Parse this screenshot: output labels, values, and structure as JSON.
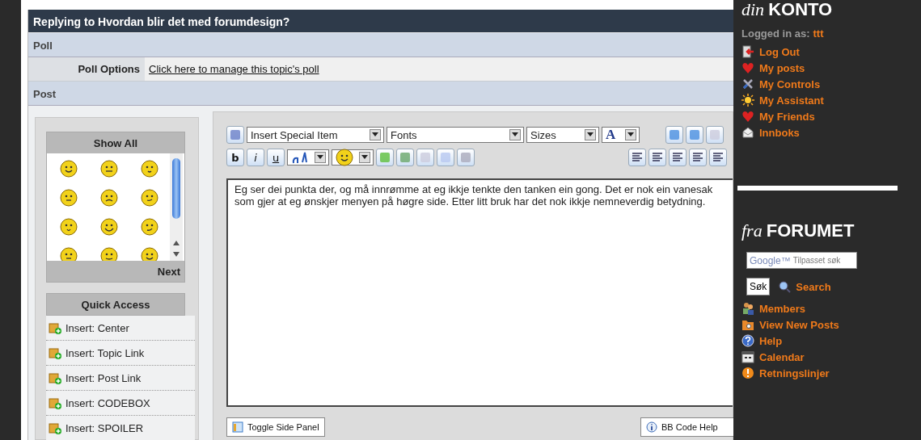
{
  "title": "Replying to Hvordan blir det med forumdesign?",
  "poll": {
    "heading": "Poll",
    "label": "Poll Options",
    "link": "Click here to manage this topic's poll"
  },
  "post": {
    "heading": "Post",
    "emoticons": {
      "header": "Show All",
      "footer": "Next"
    },
    "quick_access": {
      "header": "Quick Access",
      "items": [
        "Insert: Center",
        "Insert: Topic Link",
        "Insert: Post Link",
        "Insert: CODEBOX",
        "Insert: SPOILER"
      ]
    },
    "toolbar": {
      "dropdowns": [
        "Insert Special Item",
        "Fonts",
        "Sizes"
      ],
      "color_button": "A",
      "format_buttons": [
        "b",
        "i",
        "u"
      ]
    },
    "message": "Eg ser dei punkta der, og må innrømme at eg ikkje tenkte den tanken ein gong. Det er nok ein vanesak som gjer at eg ønskjer menyen på høgre side. Etter litt bruk har det nok ikkje nemneverdig betydning.",
    "buttons": [
      "Toggle Side Panel",
      "BB Code Help"
    ]
  },
  "sidebar": {
    "account": {
      "prefix": "din",
      "title": "KONTO",
      "logged_in_label": "Logged in as:",
      "user": "ttt",
      "links": [
        {
          "label": "Log Out"
        },
        {
          "label": "My posts"
        },
        {
          "label": "My Controls"
        },
        {
          "label": "My Assistant"
        },
        {
          "label": "My Friends"
        },
        {
          "label": "Innboks"
        }
      ]
    },
    "forum": {
      "prefix": "fra",
      "title": "FORUMET",
      "search": {
        "logo": "Google™",
        "placeholder": "Tilpasset søk",
        "button": "Søk",
        "link": "Search"
      },
      "links": [
        {
          "label": "Members"
        },
        {
          "label": "View New Posts"
        },
        {
          "label": "Help"
        },
        {
          "label": "Calendar"
        },
        {
          "label": "Retningslinjer"
        }
      ]
    }
  }
}
